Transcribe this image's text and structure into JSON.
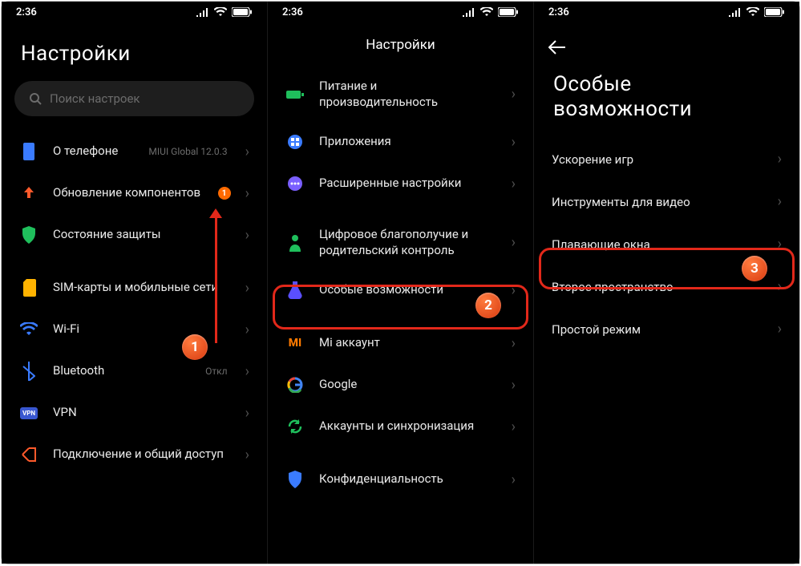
{
  "time": "2:36",
  "panel1": {
    "title": "Настройки",
    "search_ph": "Поиск настроек",
    "about": "О телефоне",
    "about_sub": "MIUI Global 12.0.3",
    "updates": "Обновление компонентов",
    "updates_badge": "1",
    "security": "Состояние защиты",
    "sim": "SIM-карты и мобильные сети",
    "wifi": "Wi-Fi",
    "bt": "Bluetooth",
    "bt_sub": "Откл",
    "vpn": "VPN",
    "share": "Подключение и общий доступ"
  },
  "panel2": {
    "title": "Настройки",
    "power": "Питание и производительность",
    "apps": "Приложения",
    "adv": "Расширенные настройки",
    "wellbeing": "Цифровое благополучие и родительский контроль",
    "special": "Особые возможности",
    "miacct": "Mi аккаунт",
    "google": "Google",
    "sync": "Аккаунты и синхронизация",
    "privacy": "Конфиденциальность"
  },
  "panel3": {
    "title1": "Особые",
    "title2": "возможности",
    "game": "Ускорение игр",
    "video": "Инструменты для видео",
    "float": "Плавающие окна",
    "second": "Второе пространство",
    "simple": "Простой режим"
  },
  "steps": {
    "s1": "1",
    "s2": "2",
    "s3": "3"
  }
}
